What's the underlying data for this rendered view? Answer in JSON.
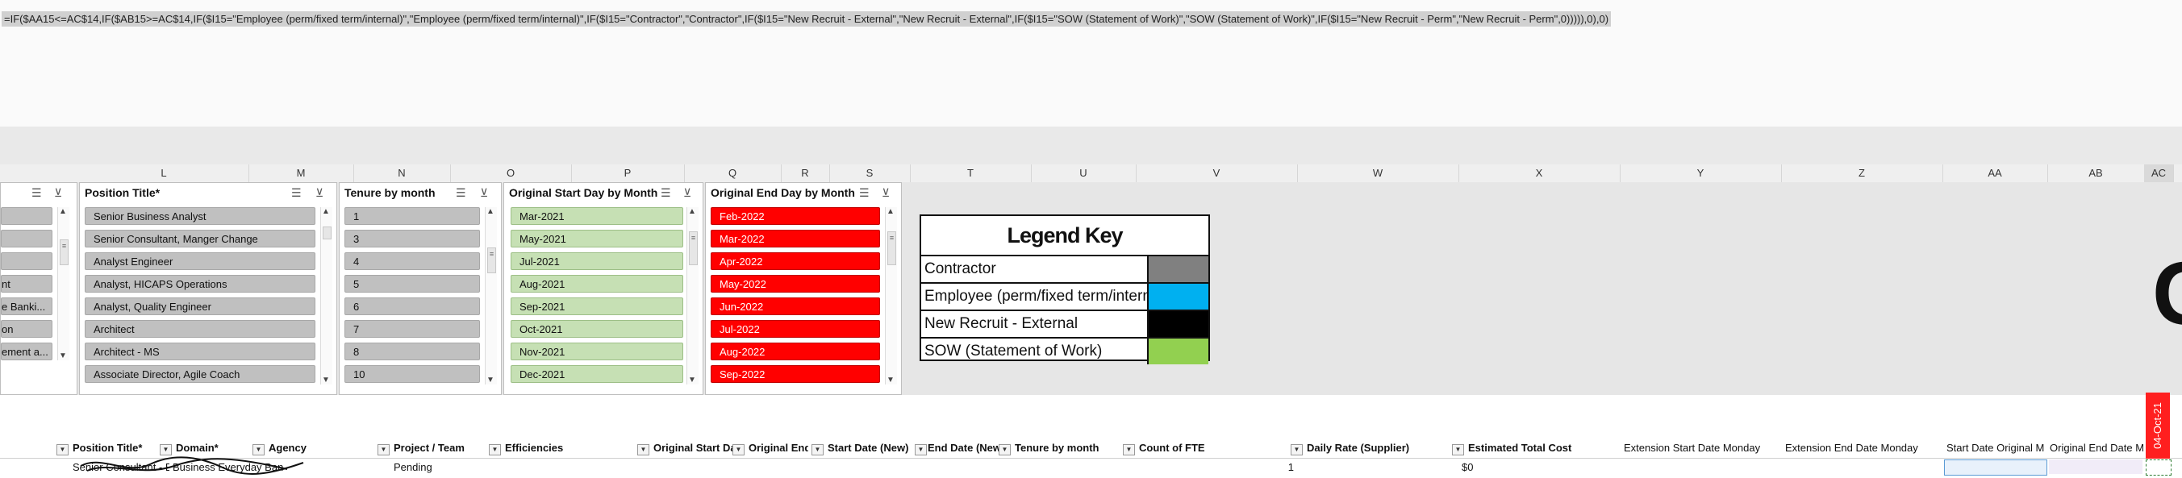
{
  "formula_bar": {
    "text": "=IF($AA15<=AC$14,IF($AB15>=AC$14,IF($I15=\"Employee (perm/fixed term/internal)\",\"Employee (perm/fixed term/internal)\",IF($I15=\"Contractor\",\"Contractor\",IF($I15=\"New Recruit - External\",\"New Recruit - External\",IF($I15=\"SOW (Statement of Work)\",\"SOW (Statement of Work)\",IF($I15=\"New Recruit - Perm\",\"New Recruit - Perm\",0))))),0),0)"
  },
  "columns": [
    "L",
    "M",
    "N",
    "O",
    "P",
    "Q",
    "R",
    "S",
    "T",
    "U",
    "V",
    "W",
    "X",
    "Y",
    "Z",
    "AA",
    "AB",
    "AC"
  ],
  "slicers": {
    "partial": {
      "items": [
        "",
        "",
        "",
        "nt",
        "e Banki...",
        "on",
        "ement a..."
      ]
    },
    "position_title": {
      "title": "Position Title*",
      "items": [
        "Senior Business Analyst",
        "Senior Consultant, Manger Change",
        "Analyst Engineer",
        "Analyst, HICAPS Operations",
        "Analyst, Quality Engineer",
        "Architect",
        "Architect - MS",
        "Associate Director, Agile Coach"
      ]
    },
    "tenure": {
      "title": "Tenure by month",
      "items": [
        "1",
        "3",
        "4",
        "5",
        "6",
        "7",
        "8",
        "10"
      ]
    },
    "start_day": {
      "title": "Original Start Day by Month",
      "items": [
        "Mar-2021",
        "May-2021",
        "Jul-2021",
        "Aug-2021",
        "Sep-2021",
        "Oct-2021",
        "Nov-2021",
        "Dec-2021"
      ]
    },
    "end_day": {
      "title": "Original End Day by Month",
      "items": [
        "Feb-2022",
        "Mar-2022",
        "Apr-2022",
        "May-2022",
        "Jun-2022",
        "Jul-2022",
        "Aug-2022",
        "Sep-2022"
      ]
    }
  },
  "legend": {
    "title": "Legend Key",
    "rows": [
      {
        "label": "Contractor",
        "color": "#808080"
      },
      {
        "label": "Employee (perm/fixed term/internal)",
        "color": "#00b0f0"
      },
      {
        "label": "New Recruit - External",
        "color": "#000000"
      },
      {
        "label": "SOW (Statement of Work)",
        "color": "#92d050"
      }
    ]
  },
  "table_headers": {
    "position_title": "Position Title*",
    "domain": "Domain*",
    "agency": "Agency",
    "project_team": "Project / Team",
    "efficiencies": "Efficiencies",
    "original_start": "Original Start Da",
    "original_end": "Original End",
    "start_date_new": "Start Date (New)",
    "end_date_new": "End Date (New",
    "tenure": "Tenure by month",
    "count_fte": "Count of FTE",
    "daily_rate": "Daily Rate (Supplier)",
    "est_total_cost": "Estimated Total Cost",
    "ext_start": "Extension Start Date Monday",
    "ext_end": "Extension End Date Monday",
    "start_original_m": "Start Date Original M",
    "original_end_m": "Original End Date M"
  },
  "data_row": {
    "position_title": "Senior Consultant - Busi",
    "domain": "Business Everyday Ban",
    "project_team": "Pending",
    "count_fte": "1",
    "est_total_cost": "$0"
  },
  "date_tab": "04-Oct-21",
  "big_letter": "G",
  "colors": {
    "slicer_gray": "#c0c0c0",
    "slicer_green": "#c6e0b4",
    "slicer_red": "#ff0000"
  }
}
